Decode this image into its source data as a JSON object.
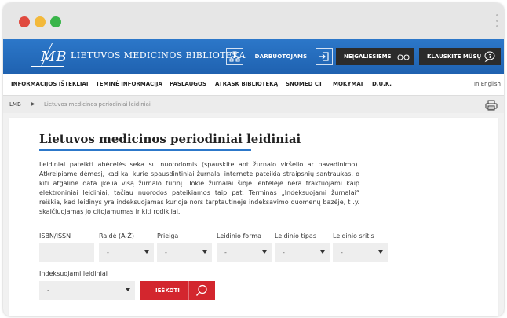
{
  "window": {
    "controls": [
      {
        "name": "close",
        "color": "#e04a3f"
      },
      {
        "name": "minimize",
        "color": "#f3b93b"
      },
      {
        "name": "maximize",
        "color": "#39b54a"
      }
    ]
  },
  "header": {
    "logo_text": "MB",
    "title": "LIETUVOS MEDICINOS BIBLIOTEKA",
    "buttons": {
      "sitemap_icon": "sitemap-icon",
      "staff": "DARBUOTOJAMS",
      "login_icon": "login-icon",
      "disabled": "NEĮGALIESIEMS",
      "disabled_icon": "glasses-icon",
      "ask": "KLAUSKITE MŪSŲ",
      "ask_icon": "speech-bubble-icon"
    },
    "colors": {
      "bar": "#1f62b0",
      "dark_button": "#2b2b2b"
    }
  },
  "nav": {
    "items": [
      "INFORMACIJOS IŠTEKLIAI",
      "TEMINĖ INFORMACIJA",
      "PASLAUGOS",
      "ATRASK BIBLIOTEKĄ",
      "SNOMED CT",
      "MOKYMAI",
      "D.U.K."
    ],
    "language": "In English"
  },
  "breadcrumb": {
    "home": "LMB",
    "separator": "▶",
    "current": "Lietuvos medicinos periodiniai leidiniai",
    "print_icon": "printer-icon"
  },
  "main": {
    "title": "Lietuvos medicinos periodiniai leidiniai",
    "intro": "Leidiniai pateikti abėcėlės seka su nuorodomis (spauskite ant žurnalo viršelio ar pavadinimo). Atkreipiame dėmesį, kad kai kurie spausdintiniai žurnalai internete pateikia straipsnių santraukas, o kiti atgaline data įkelia visą žurnalo turinį. Tokie žurnalai šioje lentelėje nėra traktuojami kaip elektroniniai leidiniai, tačiau nuorodos pateikiamos taip pat. Terminas „Indeksuojami žurnalai“ reiškia, kad leidinys yra indeksuojamas kurioje nors tarptautinėje indeksavimo duomenų bazėje, t .y. skaičiuojamas jo citojamumas ir kiti rodikliai.",
    "filters": {
      "isbn_label": "ISBN/ISSN",
      "isbn_value": "",
      "letter_label": "Raidė (A-Ž)",
      "letter_value": "-",
      "access_label": "Prieiga",
      "access_value": "-",
      "form_label": "Leidinio forma",
      "form_value": "-",
      "type_label": "Leidinio tipas",
      "type_value": "-",
      "field_label": "Leidinio sritis",
      "field_value": "-",
      "indexed_label": "Indeksuojami leidiniai",
      "indexed_value": "-"
    },
    "search_button": "IEŠKOTI",
    "search_icon": "search-icon",
    "accent_color": "#d3262e"
  }
}
